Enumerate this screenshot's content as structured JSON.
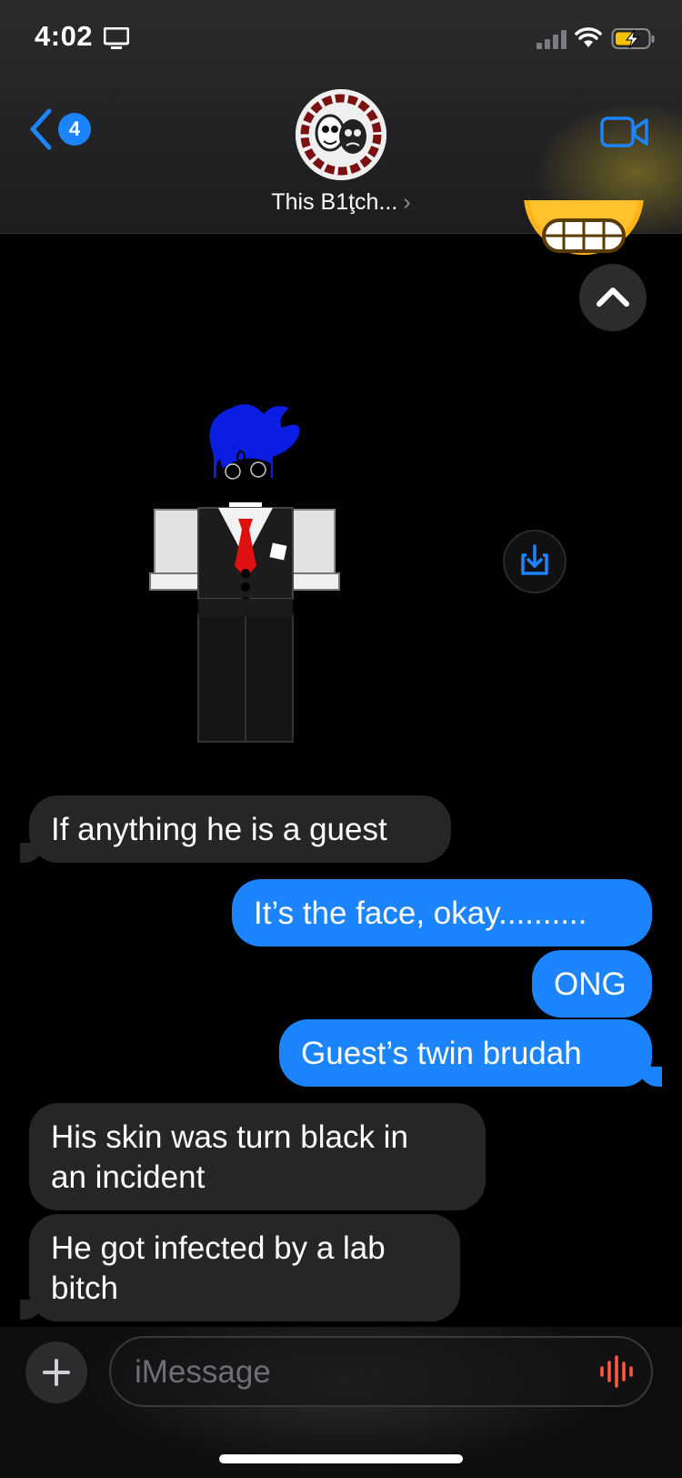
{
  "status_bar": {
    "time": "4:02",
    "screen_icon": "screen-mirroring-icon",
    "signal_icon": "cellular-signal-icon",
    "wifi_icon": "wifi-icon",
    "battery_icon": "battery-charging-icon",
    "battery_color": "#f5c200"
  },
  "header": {
    "back_icon": "chevron-left-icon",
    "back_badge": "4",
    "contact_name": "This B1ţch...",
    "contact_chevron": "›",
    "video_icon": "video-camera-icon",
    "accent_color": "#1d84ff"
  },
  "messages": [
    {
      "direction": "incoming",
      "text": "If anything he is a guest",
      "lines": [
        "If anything he is a guest"
      ]
    },
    {
      "direction": "outgoing",
      "text": "It’s the face, okay..........",
      "lines": [
        "It’s the face, okay.........."
      ]
    },
    {
      "direction": "outgoing",
      "text": "ONG",
      "lines": [
        "ONG"
      ]
    },
    {
      "direction": "outgoing",
      "text": "Guest’s twin brudah",
      "lines": [
        "Guest’s twin brudah"
      ]
    },
    {
      "direction": "incoming",
      "text": "His skin was turn black in an incident",
      "lines": [
        "His skin was turn black in",
        "an incident"
      ]
    },
    {
      "direction": "incoming",
      "text": "He got infected by a lab bitch",
      "lines": [
        "He got infected by a lab",
        "bitch"
      ]
    }
  ],
  "composer": {
    "plus_icon": "plus-icon",
    "placeholder": "iMessage",
    "mic_icon": "audio-waveform-icon"
  },
  "attachments": {
    "image_icon": "roblox-character-image",
    "save_icon": "save-download-icon",
    "scroll_icon": "chevron-up-icon",
    "emoji_icon": "grimacing-face-emoji"
  }
}
